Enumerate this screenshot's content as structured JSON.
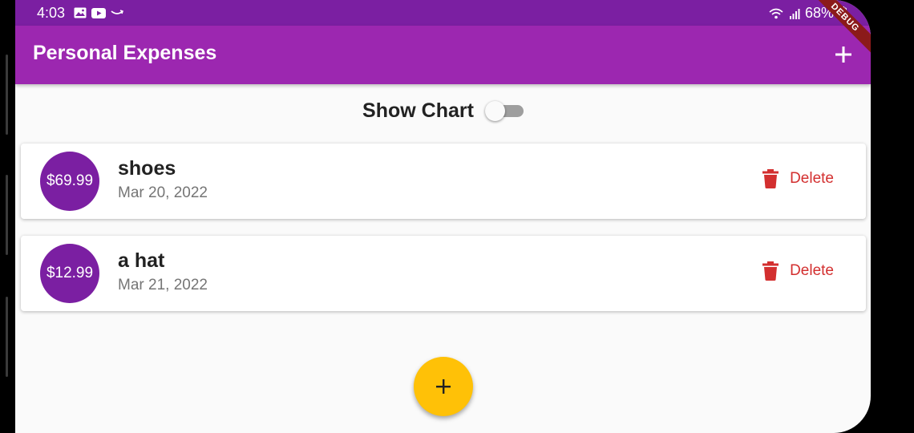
{
  "status_bar": {
    "time": "4:03",
    "battery": "68%",
    "icons": [
      "gallery-icon",
      "youtube-icon",
      "amazon-icon",
      "wifi-icon",
      "signal-icon",
      "battery-icon"
    ]
  },
  "app_bar": {
    "title": "Personal Expenses",
    "add_icon": "plus-icon",
    "debug_banner": "DEBUG"
  },
  "toggle": {
    "label": "Show Chart",
    "on": false
  },
  "transactions": [
    {
      "amount": "$69.99",
      "title": "shoes",
      "date": "Mar 20, 2022",
      "delete_label": "Delete"
    },
    {
      "amount": "$12.99",
      "title": "a hat",
      "date": "Mar 21, 2022",
      "delete_label": "Delete"
    }
  ],
  "fab": {
    "icon": "plus-icon"
  },
  "colors": {
    "primary": "#9c27b0",
    "primary_dark": "#7b1fa2",
    "accent": "#ffc107",
    "error": "#d32f2f"
  }
}
